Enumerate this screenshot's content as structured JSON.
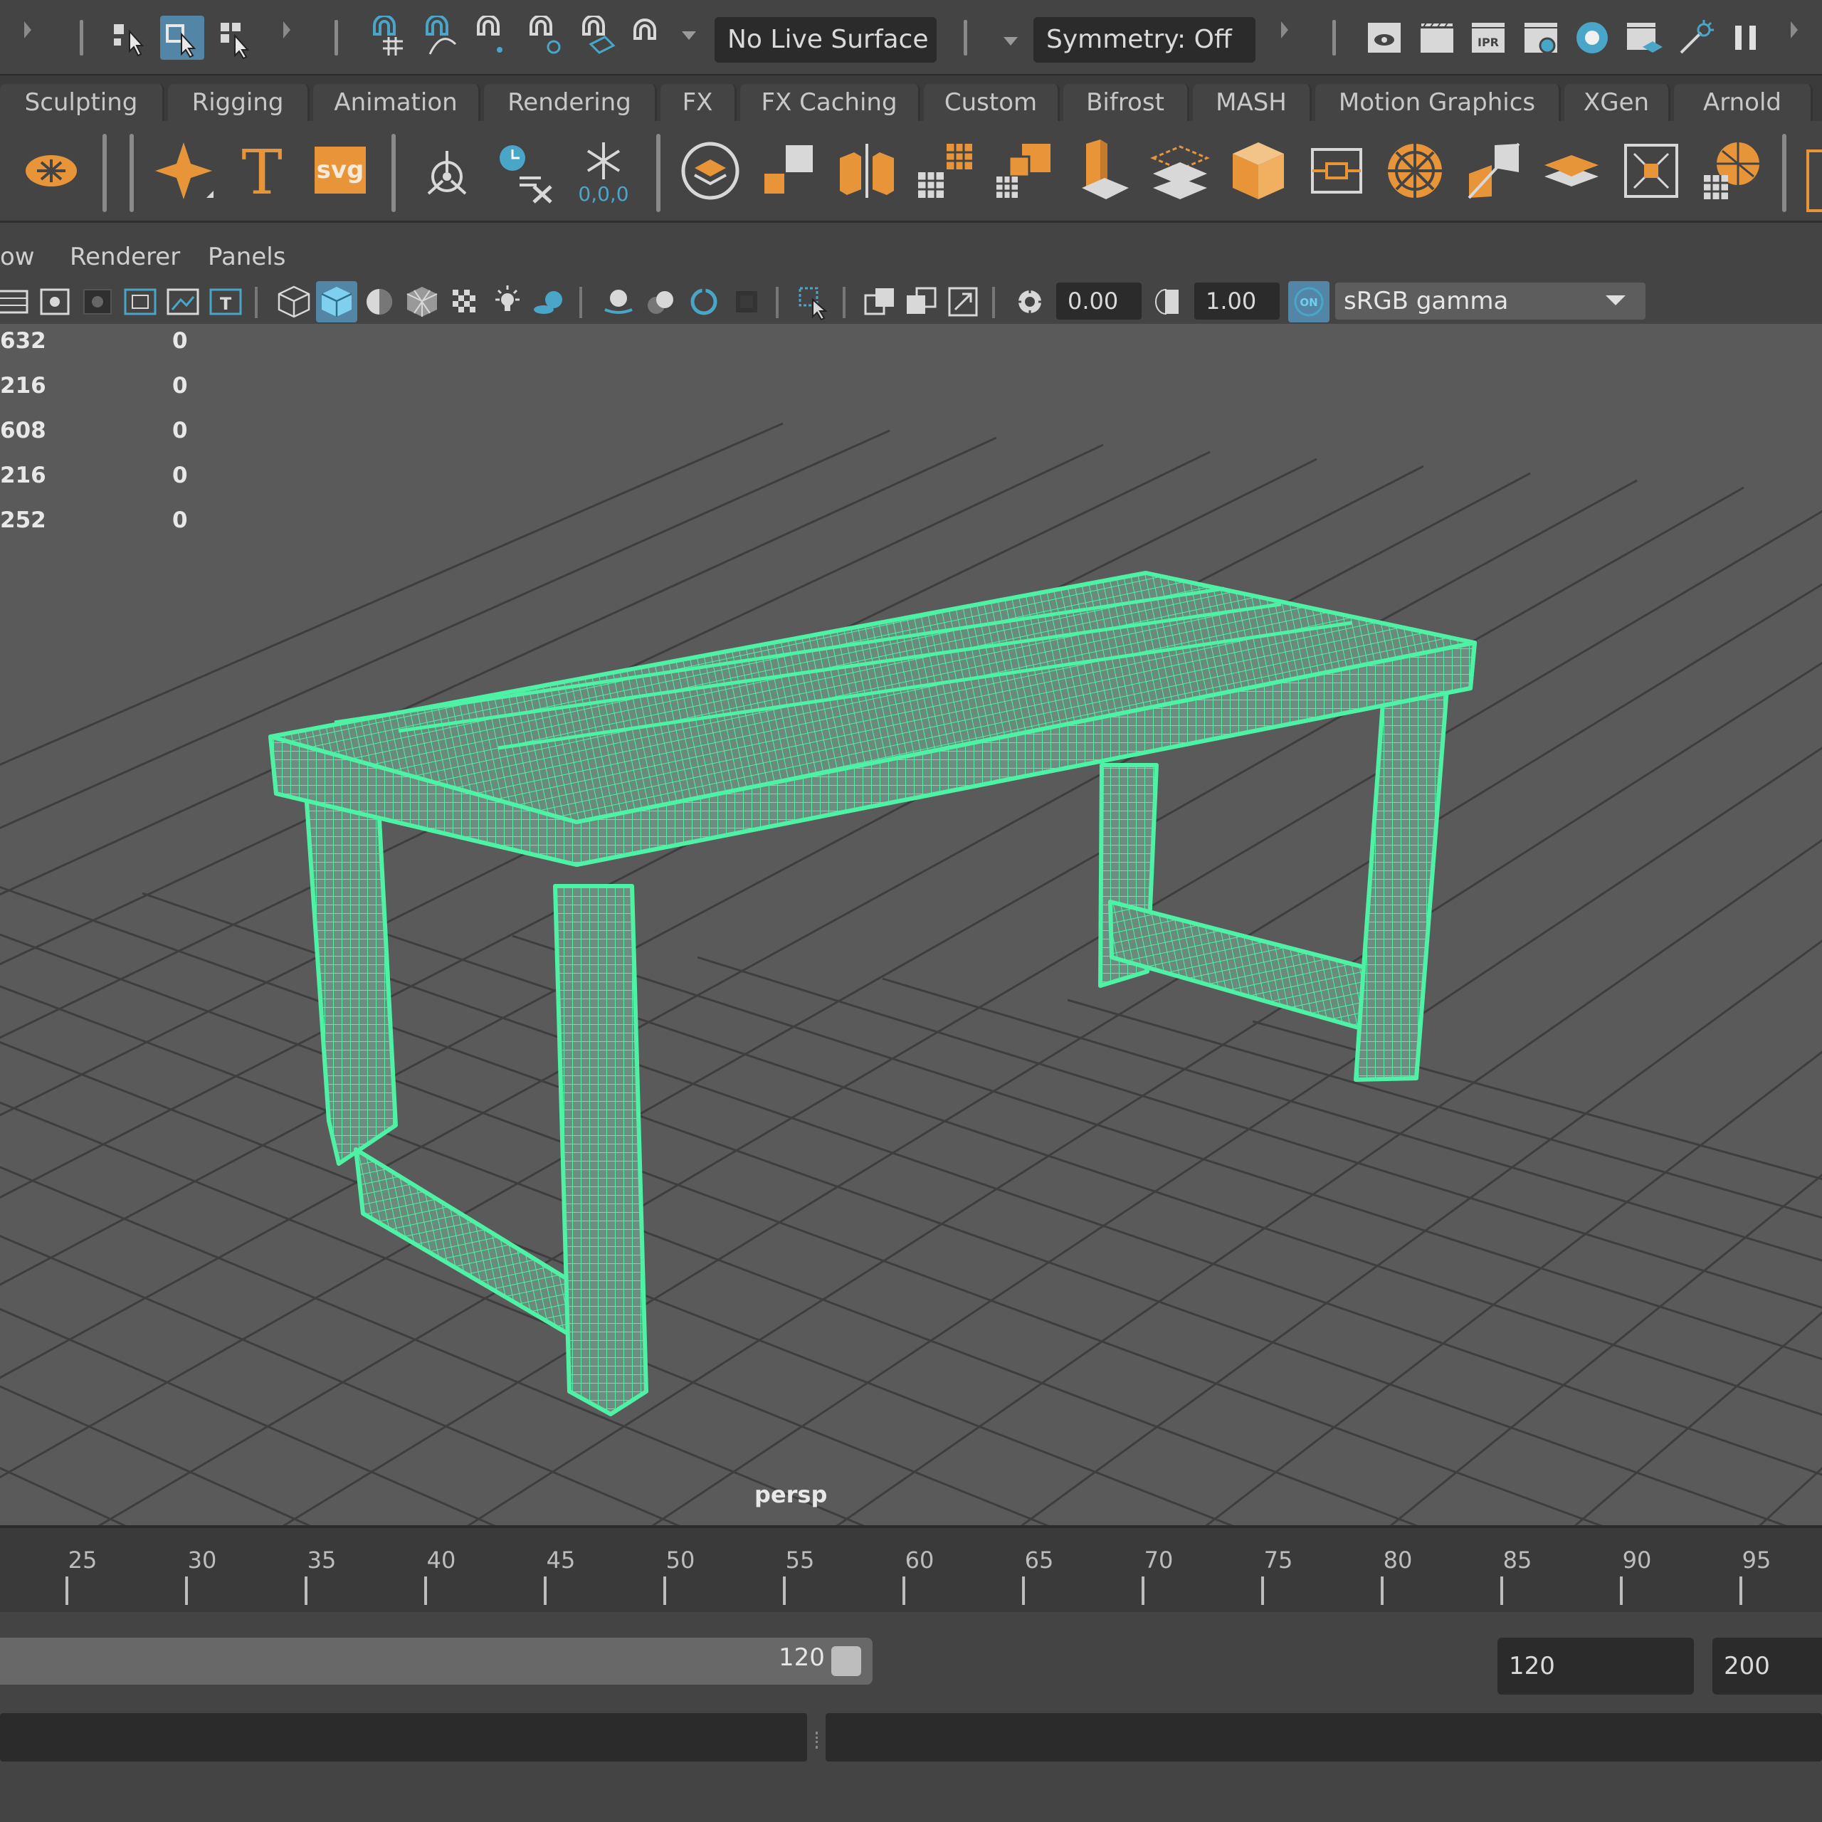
{
  "status_line": {
    "live_surface": "No Live Surface",
    "symmetry": "Symmetry: Off"
  },
  "shelf_tabs": [
    "Sculpting",
    "Rigging",
    "Animation",
    "Rendering",
    "FX",
    "FX Caching",
    "Custom",
    "Bifrost",
    "MASH",
    "Motion Graphics",
    "XGen",
    "Arnold"
  ],
  "shelf": {
    "text_tool_glyph": "T",
    "svg_tool_label": "svg",
    "freeze_transform_label": "0,0,0"
  },
  "panel_menu": [
    "ow",
    "Renderer",
    "Panels"
  ],
  "panel_toolbar": {
    "exposure": "0.00",
    "gamma": "1.00",
    "color_management_badge": "ON",
    "view_transform": "sRGB gamma"
  },
  "viewport": {
    "hud_rows": [
      {
        "label": "632",
        "value": "0"
      },
      {
        "label": "216",
        "value": "0"
      },
      {
        "label": "608",
        "value": "0"
      },
      {
        "label": "216",
        "value": "0"
      },
      {
        "label": "252",
        "value": "0"
      }
    ],
    "camera_label": "persp",
    "wireframe_color": "#4df2a4",
    "grid_color": "#3e3e3e"
  },
  "time_slider": {
    "ticks": [
      "25",
      "30",
      "35",
      "40",
      "45",
      "50",
      "55",
      "60",
      "65",
      "70",
      "75",
      "80",
      "85",
      "90",
      "95"
    ]
  },
  "range_slider": {
    "range_end": "120",
    "end_time": "120",
    "max_time": "200"
  },
  "colors": {
    "accent": "#5285a6",
    "shelf_orange": "#e8953a",
    "shelf_teal": "#4aa6c8"
  }
}
